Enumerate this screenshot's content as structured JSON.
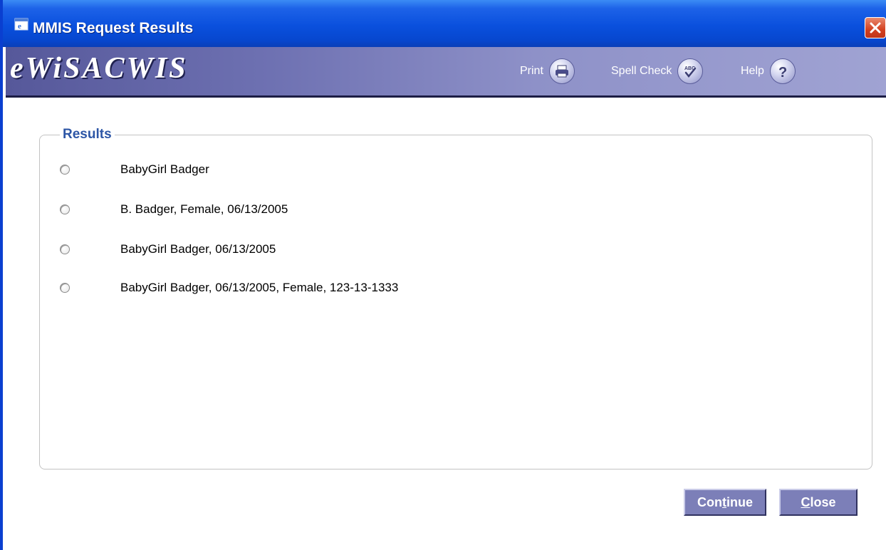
{
  "window": {
    "title": "MMIS Request Results",
    "title_icon": "ie-window-icon",
    "close_icon": "close-icon"
  },
  "banner": {
    "logo": "eWiSACWIS",
    "tools": [
      {
        "label": "Print",
        "icon": "print-icon"
      },
      {
        "label": "Spell Check",
        "icon": "spell-check-icon"
      },
      {
        "label": "Help",
        "icon": "help-icon"
      }
    ]
  },
  "results": {
    "legend": "Results",
    "items": [
      {
        "label": "BabyGirl Badger",
        "selected": false
      },
      {
        "label": "B. Badger,  Female,  06/13/2005",
        "selected": false
      },
      {
        "label": "BabyGirl Badger,  06/13/2005",
        "selected": false
      },
      {
        "label": "BabyGirl Badger,  06/13/2005,  Female,   123-13-1333",
        "selected": false
      }
    ]
  },
  "buttons": {
    "continue": {
      "pre": "Con",
      "accel": "t",
      "post": "inue"
    },
    "close": {
      "pre": "",
      "accel": "C",
      "post": "lose"
    }
  },
  "colors": {
    "titlebar": "#0a50dd",
    "banner": "#6e71b2",
    "legend_text": "#2d56a6",
    "button": "#7c7fb8",
    "close_button": "#d3401f"
  }
}
